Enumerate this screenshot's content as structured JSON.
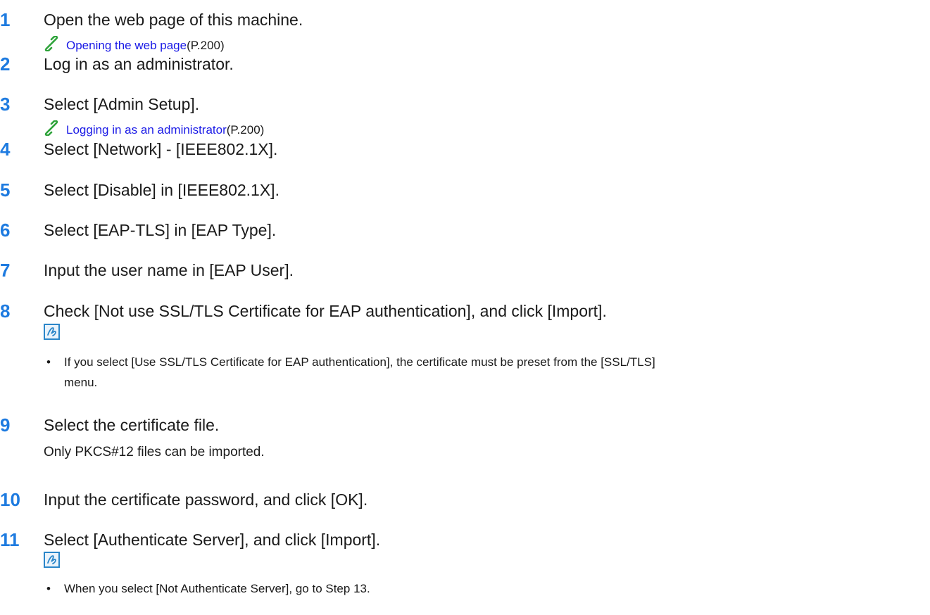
{
  "steps": [
    {
      "num": "1",
      "text": "Open the web page of this machine.",
      "link": "Opening the web page",
      "page_ref": "(P.200)"
    },
    {
      "num": "2",
      "text": "Log in as an administrator."
    },
    {
      "num": "3",
      "text": "Select [Admin Setup].",
      "link": "Logging in as an administrator",
      "page_ref": "(P.200)"
    },
    {
      "num": "4",
      "text": "Select [Network] - [IEEE802.1X]."
    },
    {
      "num": "5",
      "text": "Select [Disable] in [IEEE802.1X]."
    },
    {
      "num": "6",
      "text": "Select [EAP-TLS] in [EAP Type]."
    },
    {
      "num": "7",
      "text": "Input the user name in [EAP User]."
    },
    {
      "num": "8",
      "text": "Check [Not use SSL/TLS Certificate for EAP authentication], and click [Import].",
      "note_line1": "If you select [Use SSL/TLS Certificate for EAP authentication], the certificate must be preset from the [SSL/TLS]",
      "note_line2": "menu."
    },
    {
      "num": "9",
      "text": " Select the certificate file.",
      "subtext": "Only PKCS#12 files can be imported."
    },
    {
      "num": "10",
      "text": "Input the certificate password, and click [OK]."
    },
    {
      "num": "11",
      "text": "Select [Authenticate Server], and click [Import].",
      "note_line1": "When you select [Not Authenticate Server], go to Step 13."
    }
  ],
  "icons": {
    "link": "chain-link-icon",
    "memo": "memo-pencil-icon",
    "bullet": "•"
  },
  "colors": {
    "step_number": "#1e7be0",
    "link": "#1a1ae6",
    "link_icon": "#2ea33a",
    "memo_border": "#2a86c9"
  }
}
